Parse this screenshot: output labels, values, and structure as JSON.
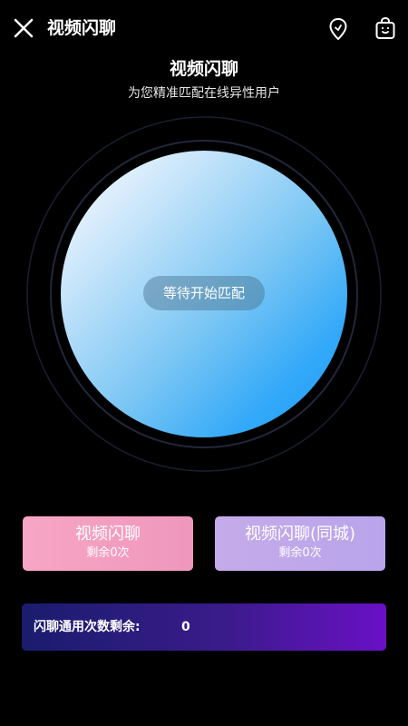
{
  "topbar": {
    "title": "视频闪聊",
    "icons": {
      "close": "close-icon",
      "location": "location-pin-icon",
      "shop": "shopping-bag-icon"
    }
  },
  "header": {
    "title": "视频闪聊",
    "subtitle": "为您精准匹配在线异性用户"
  },
  "match": {
    "status_label": "等待开始匹配"
  },
  "options": [
    {
      "title": "视频闪聊",
      "remaining": "剩余0次",
      "color": "#f3a0c1"
    },
    {
      "title": "视频闪聊(同城)",
      "remaining": "剩余0次",
      "color": "#c1a8ea"
    }
  ],
  "quota": {
    "label": "闪聊通用次数剩余:",
    "value": "0"
  },
  "colors": {
    "background": "#000000",
    "orb_start": "#ffffff",
    "orb_end": "#1c9cfc",
    "quota_start": "#1a1c6e",
    "quota_end": "#6a10c6"
  }
}
